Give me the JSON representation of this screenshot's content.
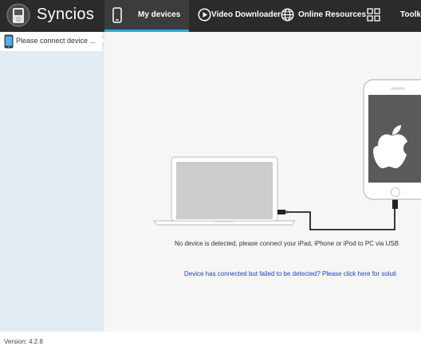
{
  "app": {
    "title": "Syncios",
    "logo_icon": "ipod-logo-icon",
    "accent_color": "#2aa6e0"
  },
  "tabs": [
    {
      "label": "My devices",
      "icon": "phone-icon",
      "active": true
    },
    {
      "label": "Video Downloader",
      "icon": "play-circle-icon",
      "active": false
    },
    {
      "label": "Online Resources",
      "icon": "globe-icon",
      "active": false
    },
    {
      "label": "",
      "icon": "grid-tiles-icon",
      "active": false
    },
    {
      "label": "Toolkit",
      "icon": "",
      "active": false
    }
  ],
  "sidebar": {
    "device_item": {
      "label": "Please connect device ...",
      "icon": "phone-icon"
    }
  },
  "main": {
    "status_message": "No device is detected, please connect your iPad, iPhone or iPod to PC via USB",
    "help_link": "Device has connected but failed to be detected? Please click here for soluti",
    "illustration": "laptop-usb-phone-illustration"
  },
  "footer": {
    "version": "Version: 4.2.8"
  }
}
